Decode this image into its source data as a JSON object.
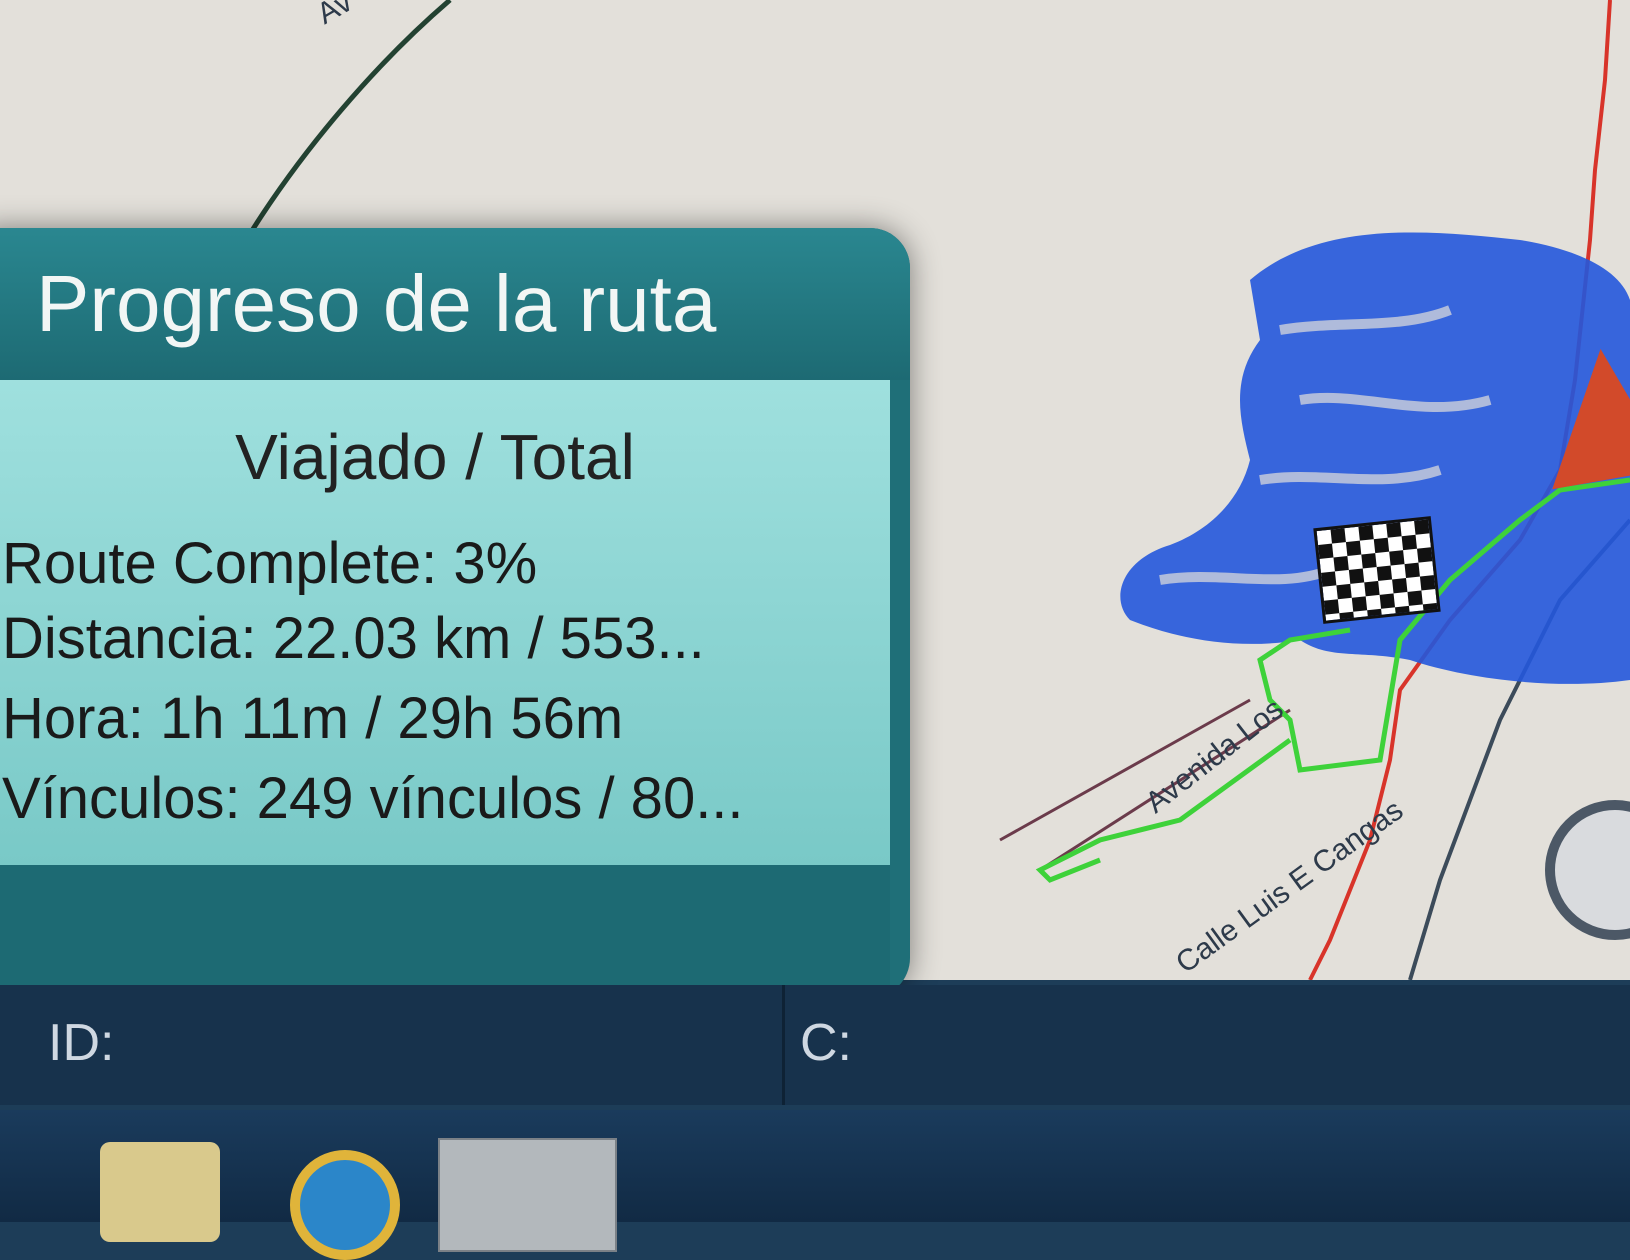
{
  "panel": {
    "title": "Progreso de la ruta",
    "subtitle": "Viajado / Total",
    "route_complete": "Route Complete: 3%",
    "distance": "Distancia: 22.03 km / 553...",
    "time": "Hora: 1h 11m / 29h 56m",
    "links": "Vínculos: 249 vínculos / 80..."
  },
  "map": {
    "street_labels": [
      "Avenida Los",
      "Calle Luis E Cangas",
      "Av"
    ],
    "colors": {
      "covered_roads": "#1f4fd6",
      "route_green": "#3ed23a",
      "route_red": "#d8342a",
      "background": "#e3e0da"
    }
  },
  "status_bar": {
    "id_label": "ID:",
    "c_label": "C:"
  },
  "taskbar": {
    "icons": [
      "folder-icon",
      "internet-explorer-icon",
      "gps-app-icon"
    ]
  }
}
